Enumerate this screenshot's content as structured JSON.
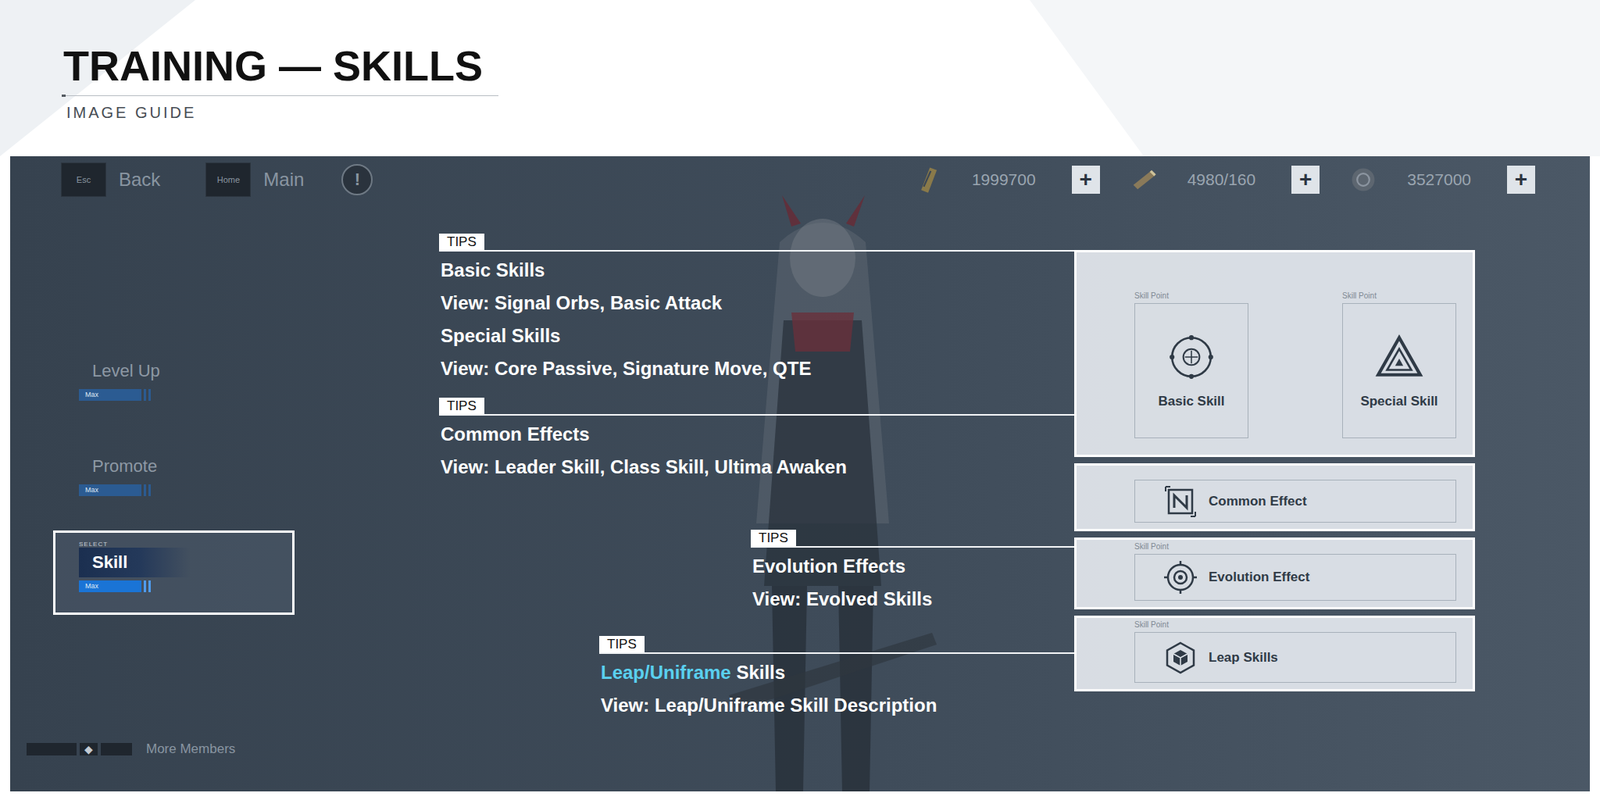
{
  "header": {
    "title": "TRAINING — SKILLS",
    "subtitle": "IMAGE GUIDE"
  },
  "topbar": {
    "nav": [
      {
        "key": "Esc",
        "label": "Back"
      },
      {
        "key": "Home",
        "label": "Main"
      }
    ],
    "alert": "!",
    "resources": [
      {
        "amount": "1999700",
        "add": "+"
      },
      {
        "amount": "4980/160",
        "add": "+"
      },
      {
        "amount": "3527000",
        "add": "+"
      }
    ]
  },
  "menu": {
    "items": [
      {
        "label": "Level Up",
        "tag": "",
        "badge": "Max",
        "level": 1,
        "selected": false
      },
      {
        "label": "Promote",
        "tag": "",
        "badge": "Max",
        "level": 1,
        "selected": false
      },
      {
        "label": "Skill",
        "tag": "SELECT",
        "badge": "Max",
        "level": 1,
        "selected": true
      }
    ],
    "more": "More Members"
  },
  "skills": {
    "cards": [
      {
        "point": "Skill Point",
        "label": "Basic Skill"
      },
      {
        "point": "Skill Point",
        "label": "Special Skill"
      }
    ],
    "rows": [
      {
        "point": "",
        "label": "Common Effect"
      },
      {
        "point": "Skill Point",
        "label": "Evolution Effect"
      },
      {
        "point": "Skill Point",
        "label": "Leap Skills"
      }
    ]
  },
  "tips": [
    {
      "tag": "TIPS",
      "lines": [
        [
          {
            "text": "Basic Skills",
            "highlight": false
          }
        ],
        [
          {
            "text": "View: Signal Orbs, Basic Attack",
            "highlight": false
          }
        ],
        [
          {
            "text": "Special Skills",
            "highlight": false
          }
        ],
        [
          {
            "text": "View: Core Passive, Signature Move, QTE",
            "highlight": false
          }
        ]
      ]
    },
    {
      "tag": "TIPS",
      "lines": [
        [
          {
            "text": "Common Effects",
            "highlight": false
          }
        ],
        [
          {
            "text": "View: Leader Skill, Class Skill, Ultima Awaken",
            "highlight": false
          }
        ]
      ]
    },
    {
      "tag": "TIPS",
      "lines": [
        [
          {
            "text": "Evolution Effects",
            "highlight": false
          }
        ],
        [
          {
            "text": "View: Evolved Skills",
            "highlight": false
          }
        ]
      ]
    },
    {
      "tag": "TIPS",
      "lines": [
        [
          {
            "text": "Leap/Uniframe",
            "highlight": true
          },
          {
            "text": " Skills",
            "highlight": false
          }
        ],
        [
          {
            "text": "View: Leap/Uniframe Skill Description",
            "highlight": false
          }
        ]
      ]
    }
  ]
}
